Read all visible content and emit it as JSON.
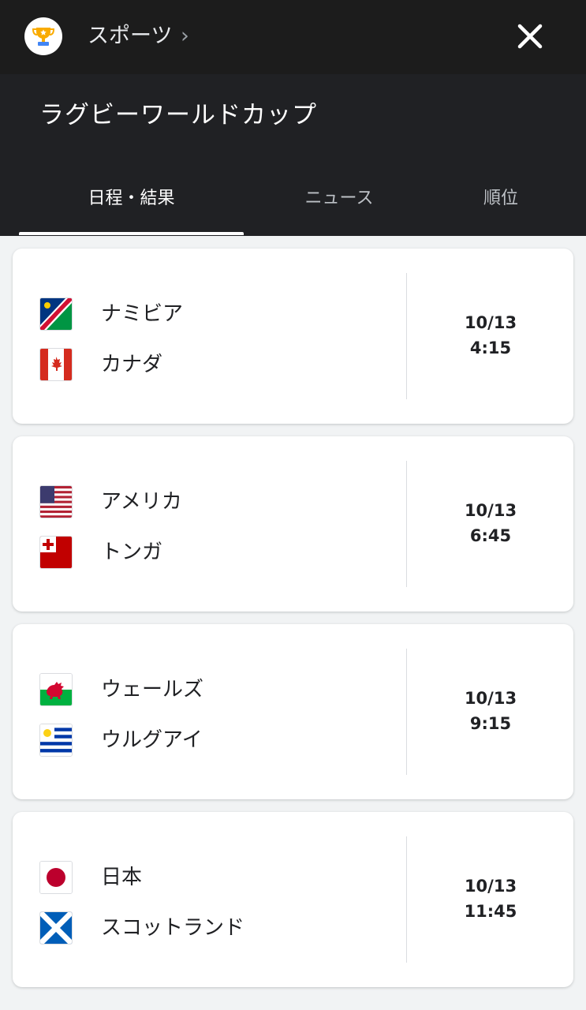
{
  "header": {
    "breadcrumb": "スポーツ",
    "chevron": "›",
    "close_icon": "close-icon",
    "trophy_icon": "trophy-icon"
  },
  "competition": {
    "title": "ラグビーワールドカップ"
  },
  "tabs": [
    {
      "label": "日程・結果",
      "active": true
    },
    {
      "label": "ニュース",
      "active": false
    },
    {
      "label": "順位",
      "active": false
    }
  ],
  "matches": [
    {
      "home": {
        "name": "ナミビア",
        "flag": "namibia-flag"
      },
      "away": {
        "name": "カナダ",
        "flag": "canada-flag"
      },
      "date": "10/13",
      "time": "4:15"
    },
    {
      "home": {
        "name": "アメリカ",
        "flag": "usa-flag"
      },
      "away": {
        "name": "トンガ",
        "flag": "tonga-flag"
      },
      "date": "10/13",
      "time": "6:45"
    },
    {
      "home": {
        "name": "ウェールズ",
        "flag": "wales-flag"
      },
      "away": {
        "name": "ウルグアイ",
        "flag": "uruguay-flag"
      },
      "date": "10/13",
      "time": "9:15"
    },
    {
      "home": {
        "name": "日本",
        "flag": "japan-flag"
      },
      "away": {
        "name": "スコットランド",
        "flag": "scotland-flag"
      },
      "date": "10/13",
      "time": "11:45"
    }
  ],
  "colors": {
    "header_bg": "#1c1c1c",
    "hero_bg": "#202124",
    "page_bg": "#f1f3f4",
    "card_bg": "#ffffff"
  }
}
